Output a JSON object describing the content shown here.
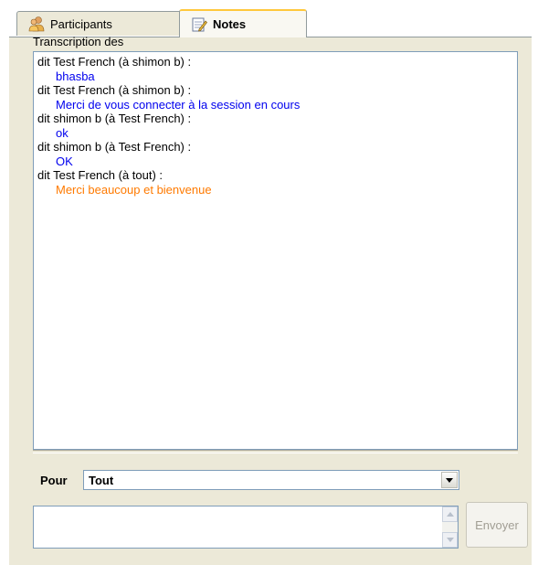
{
  "tabs": [
    {
      "label": "Participants",
      "icon": "participants-icon",
      "selected": false
    },
    {
      "label": "Notes",
      "icon": "notes-icon",
      "selected": true
    }
  ],
  "transcript": {
    "label": "Transcription des",
    "messages": [
      {
        "head": "dit Test French  (à shimon b) :",
        "body": "bhasba",
        "color": "#0000ee"
      },
      {
        "head": "dit Test French  (à shimon b) :",
        "body": "Merci de vous connecter à la session en cours",
        "color": "#0000ee"
      },
      {
        "head": "dit shimon b  (à Test French) :",
        "body": "ok",
        "color": "#0000ee"
      },
      {
        "head": "dit shimon b  (à Test French) :",
        "body": "OK",
        "color": "#0000ee"
      },
      {
        "head": "dit Test French  (à tout) :",
        "body": "Merci beaucoup et bienvenue",
        "color": "#ff7a00"
      }
    ]
  },
  "recipient": {
    "label": "Pour",
    "selected": "Tout"
  },
  "compose": {
    "value": "",
    "send_label": "Envoyer"
  }
}
